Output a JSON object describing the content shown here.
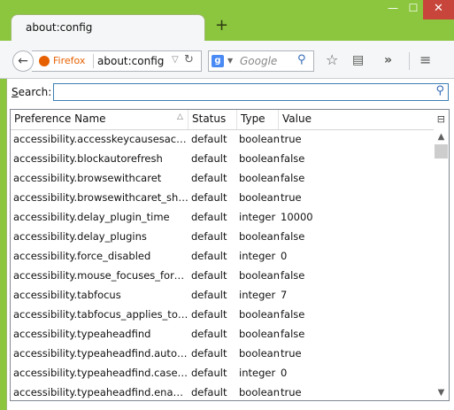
{
  "tab": {
    "title": "about:config",
    "close": "✕"
  },
  "new_tab": "+",
  "window_controls": {
    "minimize": "—",
    "maximize": "☐",
    "close": "✕"
  },
  "navbar": {
    "back": "←",
    "identity": "Firefox",
    "url": "about:config",
    "dropmarker": "▽",
    "reload": "↻",
    "search_engine": "g",
    "search_drop": "▼",
    "search_placeholder": "Google",
    "search_icon": "⚲",
    "bookmark_icon": "☆",
    "reading_icon": "▤",
    "overflow_icon": "»",
    "menu_icon": "≡"
  },
  "filter": {
    "label_underlined": "S",
    "label_rest": "earch:",
    "value": ""
  },
  "columns": {
    "name": "Preference Name",
    "sort": "△",
    "status": "Status",
    "type": "Type",
    "value": "Value",
    "picker": "⊟"
  },
  "prefs": [
    {
      "name": "accessibility.accesskeycausesactivat...",
      "status": "default",
      "type": "boolean",
      "value": "true"
    },
    {
      "name": "accessibility.blockautorefresh",
      "status": "default",
      "type": "boolean",
      "value": "false"
    },
    {
      "name": "accessibility.browsewithcaret",
      "status": "default",
      "type": "boolean",
      "value": "false"
    },
    {
      "name": "accessibility.browsewithcaret_short...",
      "status": "default",
      "type": "boolean",
      "value": "true"
    },
    {
      "name": "accessibility.delay_plugin_time",
      "status": "default",
      "type": "integer",
      "value": "10000"
    },
    {
      "name": "accessibility.delay_plugins",
      "status": "default",
      "type": "boolean",
      "value": "false"
    },
    {
      "name": "accessibility.force_disabled",
      "status": "default",
      "type": "integer",
      "value": "0"
    },
    {
      "name": "accessibility.mouse_focuses_formc...",
      "status": "default",
      "type": "boolean",
      "value": "false"
    },
    {
      "name": "accessibility.tabfocus",
      "status": "default",
      "type": "integer",
      "value": "7"
    },
    {
      "name": "accessibility.tabfocus_applies_to_xul",
      "status": "default",
      "type": "boolean",
      "value": "false"
    },
    {
      "name": "accessibility.typeaheadfind",
      "status": "default",
      "type": "boolean",
      "value": "false"
    },
    {
      "name": "accessibility.typeaheadfind.autostart",
      "status": "default",
      "type": "boolean",
      "value": "true"
    },
    {
      "name": "accessibility.typeaheadfind.casesen...",
      "status": "default",
      "type": "integer",
      "value": "0"
    },
    {
      "name": "accessibility.typeaheadfind.enables...",
      "status": "default",
      "type": "boolean",
      "value": "true"
    }
  ],
  "scrollbar": {
    "up": "▲",
    "down": "▼"
  }
}
